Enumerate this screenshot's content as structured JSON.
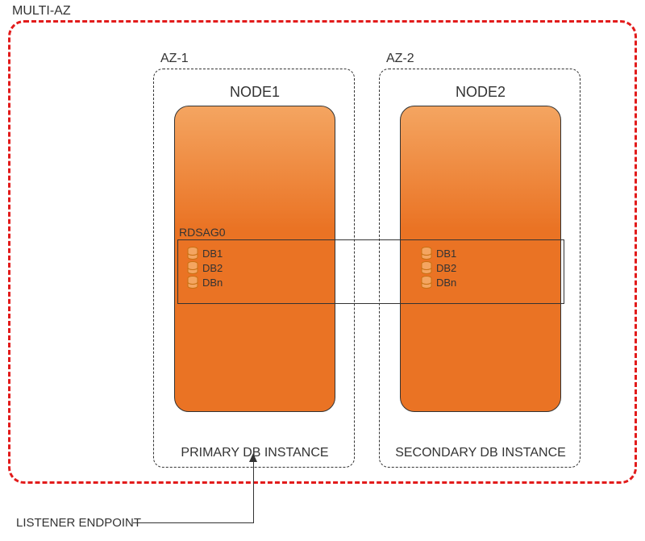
{
  "title": "MULTI-AZ",
  "az1": {
    "label": "AZ-1",
    "node_label": "NODE1",
    "instance_label": "PRIMARY DB INSTANCE"
  },
  "az2": {
    "label": "AZ-2",
    "node_label": "NODE2",
    "instance_label": "SECONDARY DB INSTANCE"
  },
  "availability_group": {
    "label": "RDSAG0",
    "databases": [
      "DB1",
      "DB2",
      "DBn"
    ]
  },
  "listener": {
    "label": "LISTENER ENDPOINT"
  },
  "colors": {
    "border_red": "#e21b1b",
    "node_orange_light": "#f4a561",
    "node_orange_dark": "#ea7324",
    "db_icon_fill": "#f4a561",
    "db_icon_stroke": "#c97012"
  }
}
